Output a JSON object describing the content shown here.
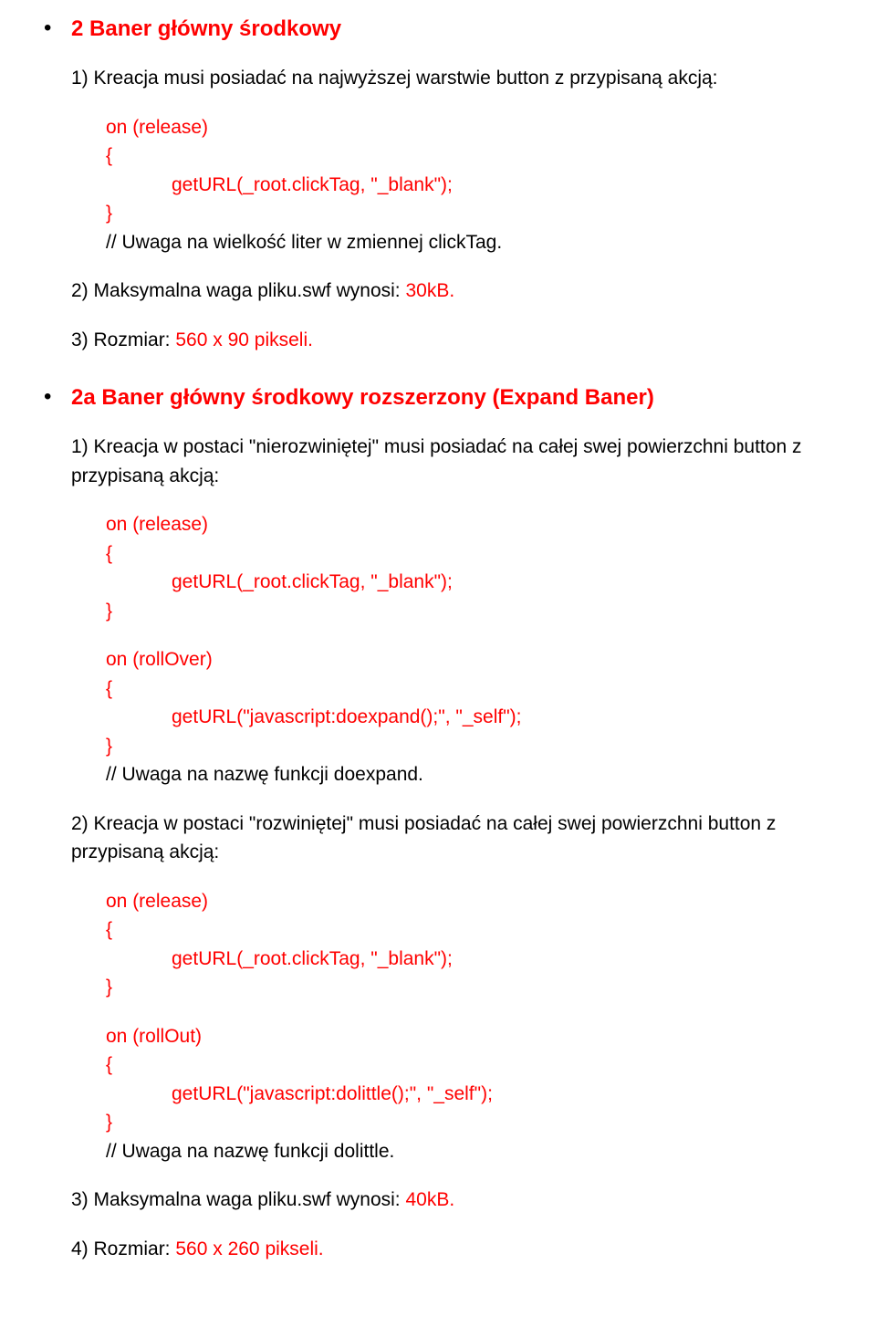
{
  "section1": {
    "heading": "2 Baner główny środkowy",
    "p1": "1) Kreacja musi posiadać na najwyższej warstwie button z przypisaną akcją:",
    "code1": {
      "l1": "on (release)",
      "l2": "{",
      "l3": "getURL(_root.clickTag, \"_blank\");",
      "l4": "}",
      "l5": "// Uwaga na wielkość liter w zmiennej clickTag."
    },
    "p2_a": "2) Maksymalna waga pliku.swf wynosi: ",
    "p2_b": "30kB.",
    "p3_a": "3) Rozmiar: ",
    "p3_b": "560 x 90 pikseli."
  },
  "section2": {
    "heading": "2a Baner główny środkowy rozszerzony (Expand Baner)",
    "p1": "1) Kreacja w postaci \"nierozwiniętej\" musi posiadać na całej swej powierzchni button z przypisaną akcją:",
    "code1": {
      "l1": "on (release)",
      "l2": "{",
      "l3": "getURL(_root.clickTag, \"_blank\");",
      "l4": "}"
    },
    "code2": {
      "l1": "on (rollOver)",
      "l2": "{",
      "l3": "getURL(\"javascript:doexpand();\", \"_self\");",
      "l4": "}",
      "l5": "// Uwaga na nazwę funkcji doexpand."
    },
    "p2": "2) Kreacja w postaci \"rozwiniętej\" musi posiadać na całej swej powierzchni button z przypisaną akcją:",
    "code3": {
      "l1": "on (release)",
      "l2": "{",
      "l3": "getURL(_root.clickTag, \"_blank\");",
      "l4": "}"
    },
    "code4": {
      "l1": "on (rollOut)",
      "l2": "{",
      "l3": "getURL(\"javascript:dolittle();\", \"_self\");",
      "l4": "}",
      "l5": "// Uwaga na nazwę funkcji dolittle."
    },
    "p3_a": "3) Maksymalna waga pliku.swf wynosi: ",
    "p3_b": "40kB.",
    "p4_a": "4) Rozmiar: ",
    "p4_b": "560 x 260 pikseli."
  }
}
